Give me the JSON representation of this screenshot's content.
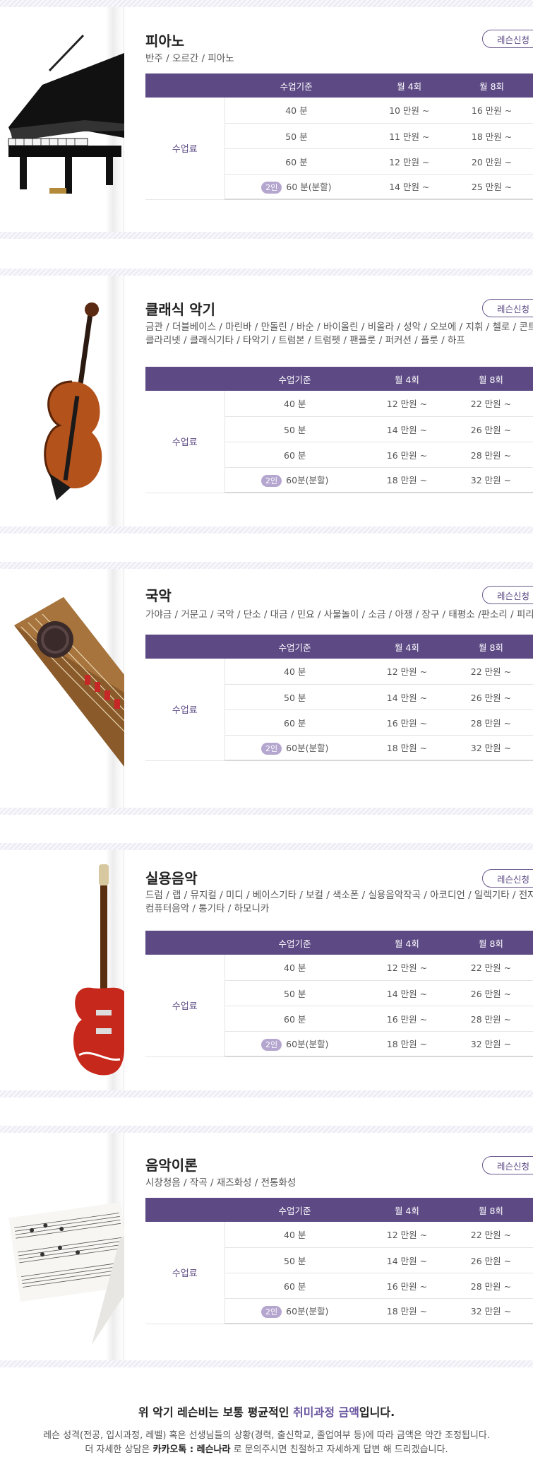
{
  "headers": {
    "col1": "수업기준",
    "col2": "월 4회",
    "col3": "월 8회"
  },
  "row_label": "수업료",
  "apply_label": "레슨신청",
  "sections": [
    {
      "title": "피아노",
      "subtitle": "반주 / 오르간 / 피아노",
      "rows": [
        {
          "tag": "",
          "time": "40 분",
          "m4": "10 만원 ~",
          "m8": "16 만원 ~"
        },
        {
          "tag": "",
          "time": "50 분",
          "m4": "11 만원 ~",
          "m8": "18 만원 ~"
        },
        {
          "tag": "",
          "time": "60 분",
          "m4": "12 만원 ~",
          "m8": "20 만원 ~"
        },
        {
          "tag": "2인",
          "time": "60 분(분할)",
          "m4": "14 만원 ~",
          "m8": "25 만원 ~"
        }
      ]
    },
    {
      "title": "클래식 악기",
      "subtitle": "금관 / 더블베이스 / 마린바 / 만돌린 / 바순 / 바이올린 / 비올라 / 성악 / 오보에 / 지휘 / 첼로 / 콘트라바순",
      "subtitle2": "클라리넷 / 클래식기타 / 타악기 / 트럼본 / 트럼펫 / 팬플룻 / 퍼커션 / 플룻 / 하프",
      "rows": [
        {
          "tag": "",
          "time": "40 분",
          "m4": "12 만원 ~",
          "m8": "22 만원 ~"
        },
        {
          "tag": "",
          "time": "50 분",
          "m4": "14 만원 ~",
          "m8": "26 만원 ~"
        },
        {
          "tag": "",
          "time": "60 분",
          "m4": "16 만원 ~",
          "m8": "28 만원 ~"
        },
        {
          "tag": "2인",
          "time": "60분(분할)",
          "m4": "18 만원 ~",
          "m8": "32 만원 ~"
        }
      ]
    },
    {
      "title": "국악",
      "subtitle": "가야금 / 거문고 / 국악 / 단소 / 대금 / 민요 / 사물놀이 / 소금 / 아쟁 / 장구 / 태평소 /판소리 / 피리 / 해금",
      "rows": [
        {
          "tag": "",
          "time": "40 분",
          "m4": "12 만원 ~",
          "m8": "22 만원 ~"
        },
        {
          "tag": "",
          "time": "50 분",
          "m4": "14 만원 ~",
          "m8": "26 만원 ~"
        },
        {
          "tag": "",
          "time": "60 분",
          "m4": "16 만원 ~",
          "m8": "28 만원 ~"
        },
        {
          "tag": "2인",
          "time": "60분(분할)",
          "m4": "18 만원 ~",
          "m8": "32 만원 ~"
        }
      ]
    },
    {
      "title": "실용음악",
      "subtitle": "드럼 / 랩 / 뮤지컬 / 미디 / 베이스기타 / 보컬 / 색소폰 / 실용음악작곡 / 아코디언 / 일렉기타 / 전자바이올린",
      "subtitle2": "컴퓨터음악 / 통기타 / 하모니카",
      "rows": [
        {
          "tag": "",
          "time": "40 분",
          "m4": "12 만원 ~",
          "m8": "22 만원 ~"
        },
        {
          "tag": "",
          "time": "50 분",
          "m4": "14 만원 ~",
          "m8": "26 만원 ~"
        },
        {
          "tag": "",
          "time": "60 분",
          "m4": "16 만원 ~",
          "m8": "28 만원 ~"
        },
        {
          "tag": "2인",
          "time": "60분(분할)",
          "m4": "18 만원 ~",
          "m8": "32 만원 ~"
        }
      ]
    },
    {
      "title": "음악이론",
      "subtitle": "시창청음 / 작곡 /  재즈화성 / 전통화성",
      "rows": [
        {
          "tag": "",
          "time": "40 분",
          "m4": "12 만원 ~",
          "m8": "22 만원 ~"
        },
        {
          "tag": "",
          "time": "50 분",
          "m4": "14 만원 ~",
          "m8": "26 만원 ~"
        },
        {
          "tag": "",
          "time": "60 분",
          "m4": "16 만원 ~",
          "m8": "28 만원 ~"
        },
        {
          "tag": "2인",
          "time": "60분(분할)",
          "m4": "18 만원 ~",
          "m8": "32 만원 ~"
        }
      ]
    }
  ],
  "footer": {
    "line1_a": "위 악기 레슨비는 보통 평균적인 ",
    "line1_b": "취미과정 금액",
    "line1_c": "입니다.",
    "line2": "레슨 성격(전공, 입시과정, 레벨) 혹은 선생님들의 상황(경력, 출신학교, 졸업여부 등)에 따라 금액은 약간 조정됩니다.",
    "line3_a": "더 자세한 상담은 ",
    "line3_b": "카카오톡 : 레슨나라",
    "line3_c": " 로 문의주시면 친절하고 자세하게 답변 해 드리겠습니다."
  }
}
